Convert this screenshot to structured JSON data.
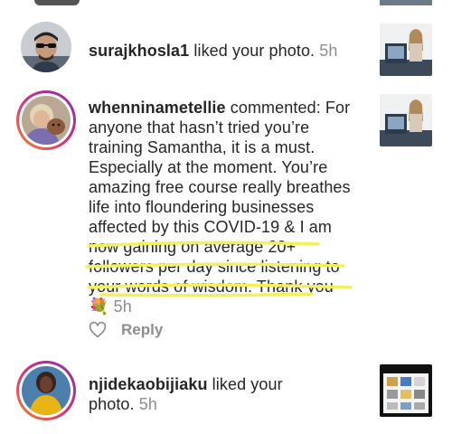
{
  "notifications": [
    {
      "username": "surajkhosla1",
      "action": "liked your photo.",
      "time": "5h"
    },
    {
      "username": "whenninametellie",
      "action": "commented:",
      "comment_lines": [
        "For",
        "anyone that hasn’t tried you’re",
        "training Samantha, it is a must.",
        "Especially at the moment. You’re",
        "amazing free course really breathes",
        "life into floundering businesses",
        "affected by this COVID-19 & I am",
        "now gaining on average 20+",
        "followers per day since listening to",
        "your words of wisdom. Thank you"
      ],
      "emoji": "💐",
      "time": "5h",
      "reply_label": "Reply"
    },
    {
      "username": "njidekaobijiaku",
      "action": "liked your",
      "action_line2": "photo.",
      "time": "5h"
    }
  ],
  "colors": {
    "text": "#262626",
    "secondary": "#8e8e8e",
    "highlight": "#f3f15a",
    "story_ring_start": "#f58529",
    "story_ring_end": "#dd2a7b"
  }
}
